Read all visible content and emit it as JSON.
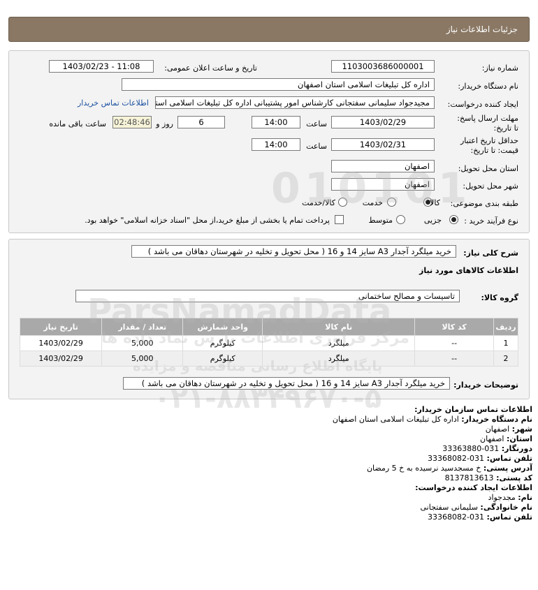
{
  "header": {
    "title": "جزئیات اطلاعات نیاز"
  },
  "form": {
    "need_number_label": "شماره نیاز:",
    "need_number": "1103003686000001",
    "announce_label": "تاریخ و ساعت اعلان عمومی:",
    "announce_value": "1403/02/23 - 11:08",
    "buyer_org_label": "نام دستگاه خریدار:",
    "buyer_org": "اداره کل تبلیغات اسلامی استان اصفهان",
    "creator_label": "ایجاد کننده درخواست:",
    "creator": "مجیدجواد سلیمانی سفتجانی کارشناس امور پشتیبانی اداره کل تبلیغات اسلامی استان اصفهان",
    "contact_link": "اطلاعات تماس خریدار",
    "deadline_label": "مهلت ارسال پاسخ: تا تاریخ:",
    "deadline_date": "1403/02/29",
    "time_label": "ساعت",
    "deadline_time": "14:00",
    "days_value": "6",
    "days_label": "روز و",
    "remaining_time": "02:48:46",
    "remaining_label": "ساعت باقی مانده",
    "validity_label": "حداقل تاریخ اعتبار قیمت: تا تاریخ:",
    "validity_date": "1403/02/31",
    "validity_time": "14:00",
    "province_label": "استان محل تحویل:",
    "province": "اصفهان",
    "city_label": "شهر محل تحویل:",
    "city": "اصفهان",
    "category_label": "طبقه بندی موضوعی:",
    "category_options": [
      "کالا",
      "خدمت",
      "کالا/خدمت"
    ],
    "process_label": "نوع فرآیند خرید :",
    "process_options": [
      "جزیی",
      "متوسط"
    ],
    "payment_note": "پرداخت تمام یا بخشی از مبلغ خرید،از محل \"اسناد خزانه اسلامی\" خواهد بود."
  },
  "detail": {
    "summary_label": "شرح کلی نیاز:",
    "summary": "خرید میلگرد آجدار A3 سایز 14 و 16 ( محل تحویل و تخلیه در شهرستان دهاقان می باشد )",
    "goods_title": "اطلاعات کالاهای مورد نیاز",
    "group_label": "گروه کالا:",
    "group_value": "تاسیسات و مصالح ساختمانی",
    "table": {
      "headers": [
        "ردیف",
        "کد کالا",
        "نام کالا",
        "واحد شمارش",
        "تعداد / مقدار",
        "تاریخ نیاز"
      ],
      "rows": [
        [
          "1",
          "--",
          "میلگرد",
          "کیلوگرم",
          "5,000",
          "1403/02/29"
        ],
        [
          "2",
          "--",
          "میلگرد",
          "کیلوگرم",
          "5,000",
          "1403/02/29"
        ]
      ]
    },
    "buyer_notes_label": "توضیحات خریدار:",
    "buyer_notes": "خرید میلگرد آجدار A3 سایز 14 و 16 ( محل تحویل و تخلیه در شهرستان دهاقان می باشد )"
  },
  "contact": {
    "org_title": "اطلاعات تماس سازمان خریدار:",
    "buyer_name_label": "نام دستگاه خریدار:",
    "buyer_name": "اداره کل تبلیغات اسلامی استان اصفهان",
    "city_label": "شهر:",
    "city": "اصفهان",
    "province_label": "استان:",
    "province": "اصفهان",
    "fax_label": "دورنگار:",
    "fax": "031-33363880",
    "phone_label": "تلفن تماس:",
    "phone": "031-33368082",
    "address_label": "آدرس پستی:",
    "address": "خ مسجدسید نرسیده به خ 5 رمضان",
    "postal_label": "کد پستی:",
    "postal": "8137813613",
    "creator_title": "اطلاعات ایجاد کننده درخواست:",
    "first_name_label": "نام:",
    "first_name": "مجدجواد",
    "last_name_label": "نام خانوادگی:",
    "last_name": "سلیمانی سفتجانی",
    "creator_phone_label": "تلفن تماس:",
    "creator_phone": "031-33368082"
  },
  "watermark": {
    "brand": "ParsNamadData",
    "line1": "مرکز فراوری اطلاعات پارس نماد داده ها",
    "line2": "پایگاه اطلاع رسانی مناقصه و مزایده",
    "phone": "۰۲۱-۸۸۳۴۹۶۷۰-۵",
    "digits": "010101"
  },
  "colors": {
    "header": "#8a7864",
    "link": "#1a4fa0",
    "table_header": "#a9a9a9"
  }
}
